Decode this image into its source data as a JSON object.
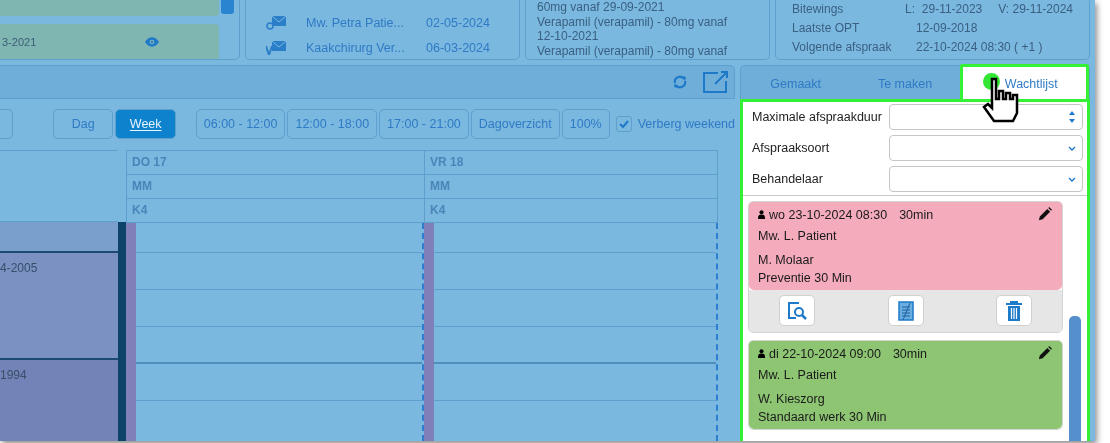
{
  "top_panels": {
    "card_panel": {
      "date": "3-2021"
    },
    "messages": [
      {
        "kind": "email",
        "name": "Mw. Petra Patie...",
        "date": "02-05-2024"
      },
      {
        "kind": "letter",
        "name": "Kaakchirurg Ver...",
        "date": "06-03-2024"
      }
    ],
    "medication": [
      "60mg vanaf 29-09-2021",
      "Verapamil (verapamil) - 80mg vanaf",
      "12-10-2021",
      "Verapamil (verapamil) - 80mg vanaf"
    ],
    "info": [
      {
        "label": "Bitewings",
        "values": [
          "L:  29-11-2023",
          "V: 29-11-2024"
        ]
      },
      {
        "label": "Laatste OPT",
        "values": [
          "12-09-2018"
        ]
      },
      {
        "label": "Volgende afspraak",
        "values": [
          "22-10-2024 08:30 ( +1 )"
        ]
      }
    ]
  },
  "toolbar": {
    "view_buttons": [
      {
        "label": "Dag",
        "selected": false
      },
      {
        "label": "Week",
        "selected": true
      }
    ],
    "range_buttons": [
      "06:00 - 12:00",
      "12:00 - 18:00",
      "17:00 - 21:00",
      "Dagoverzicht",
      "100%"
    ],
    "hide_weekend": {
      "label": "Verberg weekend",
      "checked": true
    }
  },
  "calendar": {
    "columns": [
      {
        "day": "DO 17",
        "practitioner": "MM",
        "room": "K4"
      },
      {
        "day": "VR 18",
        "practitioner": "MM",
        "room": "K4"
      }
    ],
    "left_blocks": [
      {
        "kind": "plain"
      },
      {
        "kind": "dated",
        "text": "4-2005"
      },
      {
        "kind": "dated",
        "text": "1994"
      }
    ]
  },
  "side_panel": {
    "tabs": [
      {
        "label": "Gemaakt",
        "selected": false
      },
      {
        "label": "Te maken",
        "selected": false
      },
      {
        "label": "Wachtlijst",
        "selected": true
      }
    ],
    "filters": [
      {
        "kind": "spinner",
        "label": "Maximale afspraakduur"
      },
      {
        "kind": "select",
        "label": "Afspraaksoort"
      },
      {
        "kind": "select",
        "label": "Behandelaar"
      }
    ],
    "appointments": [
      {
        "when": "wo 23-10-2024 08:30",
        "duration": "30min",
        "patient": "Mw. L. Patient",
        "practitioner": "M. Molaar",
        "type": "Preventie 30 Min",
        "color": "#f4abbc",
        "actions": true
      },
      {
        "when": "di 22-10-2024 09:00",
        "duration": "30min",
        "patient": "Mw. L. Patient",
        "practitioner": "W. Kieszorg",
        "type": "Standaard werk 30 Min",
        "color": "#8dc573",
        "actions": false
      }
    ]
  }
}
